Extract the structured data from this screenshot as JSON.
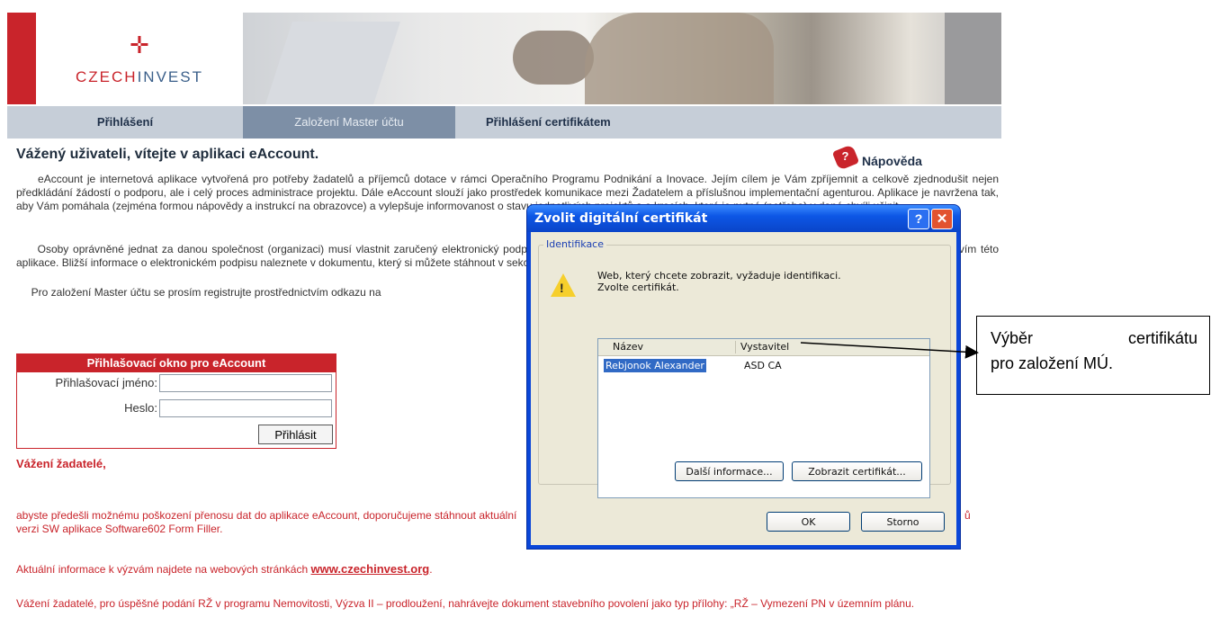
{
  "header": {
    "logo_text_red": "CZECH",
    "logo_text_blue": "INVEST",
    "logo_mark": "✛"
  },
  "nav": {
    "tabs": [
      {
        "label": "Přihlášení",
        "active": false
      },
      {
        "label": "Založení Master účtu",
        "active": true
      },
      {
        "label": "Přihlášení certifikátem",
        "active": false
      }
    ]
  },
  "main": {
    "title": "Vážený uživateli, vítejte v aplikaci eAccount.",
    "help_label": "Nápověda",
    "paragraph1": "     eAccount je internetová aplikace vytvořená pro potřeby žadatelů a příjemců dotace v rámci Operačního Programu Podnikání a Inovace. Jejím cílem je Vám zpříjemnit a celkově zjednodušit nejen předkládání žádostí o podporu, ale i celý proces administrace projektu. Dále eAccount slouží jako prostředek komunikace mezi Žadatelem a příslušnou implementační agenturou. Aplikace je navržena tak, aby Vám pomáhala (zejména formou nápovědy a instrukcí na obrazovce) a vylepšuje informovanost o stavu jednotlivých projektů a o krocích, které je nutné (potřeba) v dané chvíli učinit.",
    "paragraph2": "     Osoby oprávněné jednat za danou společnost (organizaci) musí vlastnit zaručený elektronický podpis, kterým bude podepisována veškerá dokumentace podávaná elektronicky prostřednictvím této aplikace. Bližší informace o elektronickém podpisu naleznete v dokumentu, který si můžete stáhnout v sekci Technické předpoklady. Více informací",
    "paragraph3": "     Pro založení Master účtu se prosím registrujte prostřednictvím odkazu na",
    "login": {
      "header": "Přihlašovací okno pro eAccount",
      "username_label": "Přihlašovací jméno:",
      "password_label": "Heslo:",
      "username_value": "",
      "password_value": "",
      "submit_label": "Přihlásit"
    },
    "dear_title": "Vážení žadatelé,",
    "warning1": "abyste předešli možnému poškození přenosu dat do aplikace eAccount, doporučujeme stáhnout aktuální verzi SW aplikace Software602 Form Filler.",
    "warning1_tail": "ů",
    "info_prefix": "Aktuální informace k výzvám najdete na webových stránkách ",
    "info_link": "www.czechinvest.org",
    "info_suffix": ".",
    "warning2": "Vážení žadatelé, pro úspěšné podání RŽ v programu Nemovitosti, Výzva II – prodloužení, nahrávejte dokument stavebního povolení jako typ přílohy: „RŽ – Vymezení PN v územním plánu."
  },
  "dialog": {
    "title": "Zvolit digitální certifikát",
    "help_button": "?",
    "close_button": "✕",
    "group_label": "Identifikace",
    "message_line1": "Web, který chcete zobrazit, vyžaduje identifikaci.",
    "message_line2": "Zvolte certifikát.",
    "columns": {
      "name": "Název",
      "issuer": "Vystavitel"
    },
    "certificates": [
      {
        "name": "Rebjonok Alexander",
        "issuer": "ASD CA",
        "selected": true
      }
    ],
    "more_info_button": "Další informace...",
    "view_cert_button": "Zobrazit certifikát...",
    "ok_button": "OK",
    "cancel_button": "Storno"
  },
  "callout": {
    "word1": "Výběr",
    "word2": "certifikátu",
    "line2": "pro založení MÚ."
  },
  "colors": {
    "brand_red": "#c9242b",
    "nav_bg": "#c6ced8",
    "nav_active": "#7d8fa6",
    "xp_titlebar": "#0a46d8",
    "selection": "#316ac5"
  }
}
